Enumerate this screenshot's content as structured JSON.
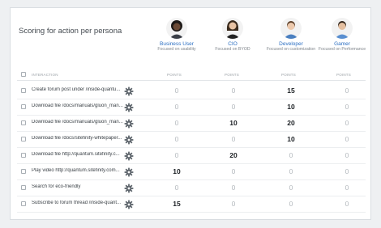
{
  "title": "Scoring for action per persona",
  "personas": [
    {
      "name": "Business User",
      "desc": "Focused on usability",
      "icon": "business-user-avatar"
    },
    {
      "name": "CIO",
      "desc": "Focused on BYOD",
      "icon": "cio-avatar"
    },
    {
      "name": "Developer",
      "desc": "Focused on customization",
      "icon": "developer-avatar"
    },
    {
      "name": "Gamer",
      "desc": "Focused on Performance",
      "icon": "gamer-avatar"
    }
  ],
  "header": {
    "interaction": "INTERACTION",
    "points": "POINTS"
  },
  "rows": [
    {
      "name": "Create forum post under /inside-quantu...",
      "values": [
        "0",
        "0",
        "15",
        "0"
      ]
    },
    {
      "name": "Download file /docs/manuals/gluon_man...",
      "values": [
        "0",
        "0",
        "10",
        "0"
      ]
    },
    {
      "name": "Download file /docs/manuals/gluon_man...",
      "values": [
        "0",
        "10",
        "20",
        "0"
      ]
    },
    {
      "name": "Download file /docs/sitefinity-whitepaper...",
      "values": [
        "0",
        "0",
        "10",
        "0"
      ]
    },
    {
      "name": "Download file http://quantum.sitefinity.c...",
      "values": [
        "0",
        "20",
        "0",
        "0"
      ]
    },
    {
      "name": "Play video http://quantum.sitefinity.com...",
      "values": [
        "10",
        "0",
        "0",
        "0"
      ]
    },
    {
      "name": "Search for eco-friendly",
      "values": [
        "0",
        "0",
        "0",
        "0"
      ]
    },
    {
      "name": "Subscribe to forum thread /inside-quant...",
      "values": [
        "15",
        "0",
        "0",
        "0"
      ]
    }
  ],
  "colors": {
    "accent": "#2a6ec2",
    "zero": "#b4b9be",
    "value": "#1c2024"
  }
}
